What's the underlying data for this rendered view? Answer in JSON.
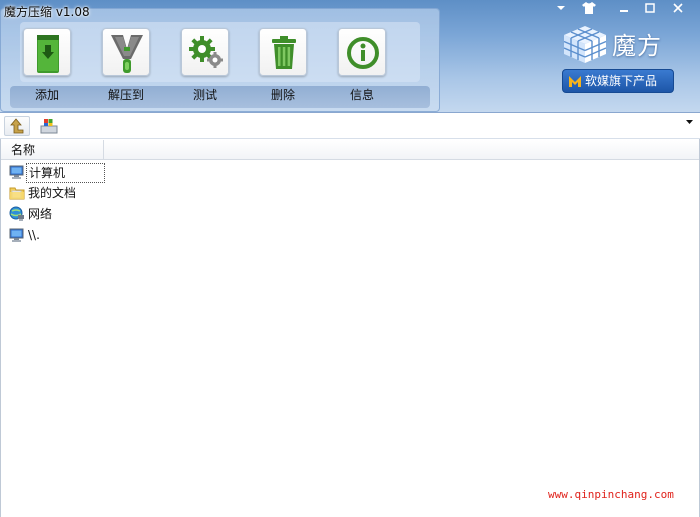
{
  "window": {
    "title": "魔方压缩 v1.08",
    "controls": {
      "menu": "▼",
      "skin": "skin",
      "min": "─",
      "max": "□",
      "close": "✕"
    }
  },
  "toolbar": {
    "add_label": "添加",
    "extract_label": "解压到",
    "test_label": "测试",
    "delete_label": "删除",
    "info_label": "信息"
  },
  "brand": {
    "name": "魔方",
    "tagline": "软媒旗下产品",
    "colors": {
      "accent": "#2b6dc4",
      "icon_green": "#3a8e2a"
    }
  },
  "addressbar": {
    "path": "",
    "dropdown": "▼"
  },
  "filelist": {
    "column_name": "名称",
    "items": [
      {
        "label": "计算机",
        "icon": "computer-icon"
      },
      {
        "label": "我的文档",
        "icon": "folder-icon"
      },
      {
        "label": "网络",
        "icon": "network-icon"
      },
      {
        "label": "\\\\.",
        "icon": "computer-icon"
      }
    ]
  },
  "watermark": "www.qinpinchang.com"
}
